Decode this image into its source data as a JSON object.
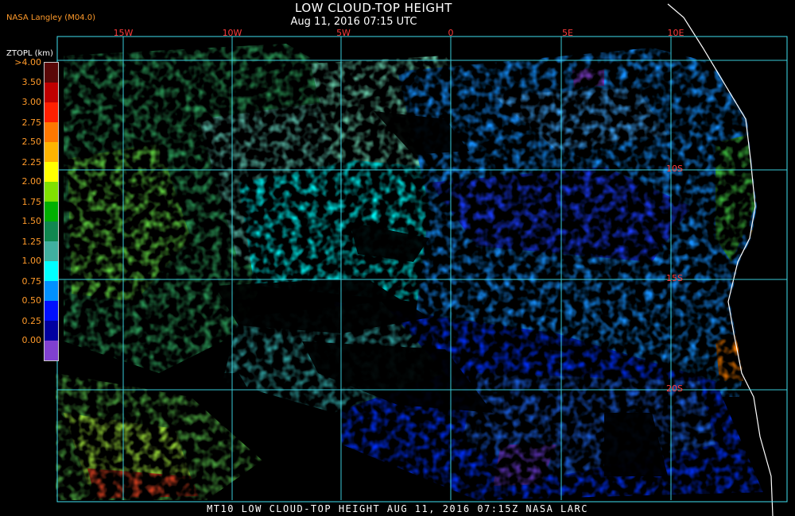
{
  "header": {
    "title": "LOW CLOUD-TOP HEIGHT",
    "subtitle": "Aug 11, 2016 07:15 UTC",
    "agency": "NASA Langley (M04.0)"
  },
  "legend": {
    "title": "ZTOPL (km)",
    "ticks": [
      ">4.00",
      "3.50",
      "3.00",
      "2.75",
      "2.50",
      "2.25",
      "2.00",
      "1.75",
      "1.50",
      "1.25",
      "1.00",
      "0.75",
      "0.50",
      "0.25",
      "0.00"
    ],
    "colors": [
      "#5a0808",
      "#c00000",
      "#ff2000",
      "#ff7800",
      "#ffb400",
      "#ffff00",
      "#80e000",
      "#00b000",
      "#108850",
      "#40b0a0",
      "#00ffff",
      "#0090ff",
      "#0010ff",
      "#0000a0",
      "#8040d0"
    ]
  },
  "grid": {
    "longitudes": [
      "15W",
      "10W",
      "5W",
      "0",
      "5E",
      "10E"
    ],
    "latitudes": [
      "10S",
      "15S",
      "20S"
    ],
    "line_color": "#40e0f0",
    "label_color": "#ff3b3b"
  },
  "footer": {
    "text": "MT10  LOW CLOUD-TOP HEIGHT   AUG 11, 2016 07:15Z   NASA LARC"
  }
}
